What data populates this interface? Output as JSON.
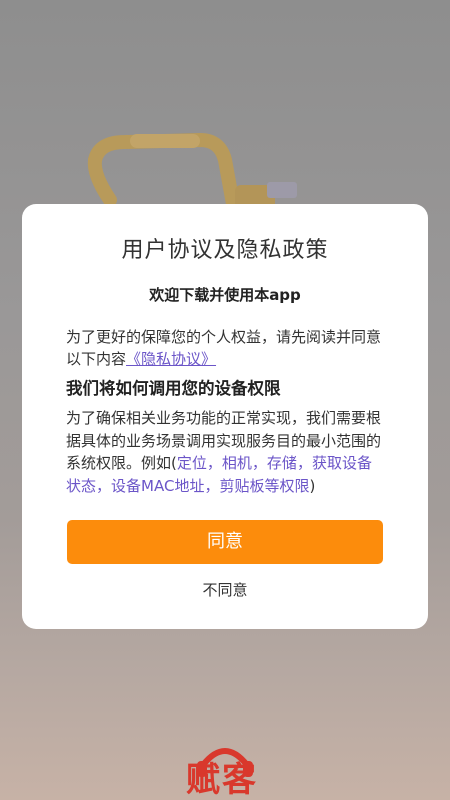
{
  "dialog": {
    "title": "用户协议及隐私政策",
    "welcome": "欢迎下载并使用本app",
    "intro_prefix": "为了更好的保障您的个人权益，请先阅读并同意以下内容",
    "privacy_link": "《隐私协议》",
    "permission_heading": "我们将如何调用您的设备权限",
    "permission_prefix": "为了确保相关业务功能的正常实现，我们需要根据具体的业务场景调用实现服务目的最小范围的系统权限。例如(",
    "permissions": [
      "定位",
      "相机",
      "存储",
      "获取设备状态",
      "设备MAC地址",
      "剪贴板等权限"
    ],
    "separator": "，",
    "permission_suffix": ")",
    "agree_label": "同意",
    "disagree_label": "不同意"
  },
  "background": {
    "brand_text": "赋客"
  },
  "colors": {
    "accent": "#fc8c0c",
    "link": "#6b55c8",
    "brand": "#d9382c"
  }
}
